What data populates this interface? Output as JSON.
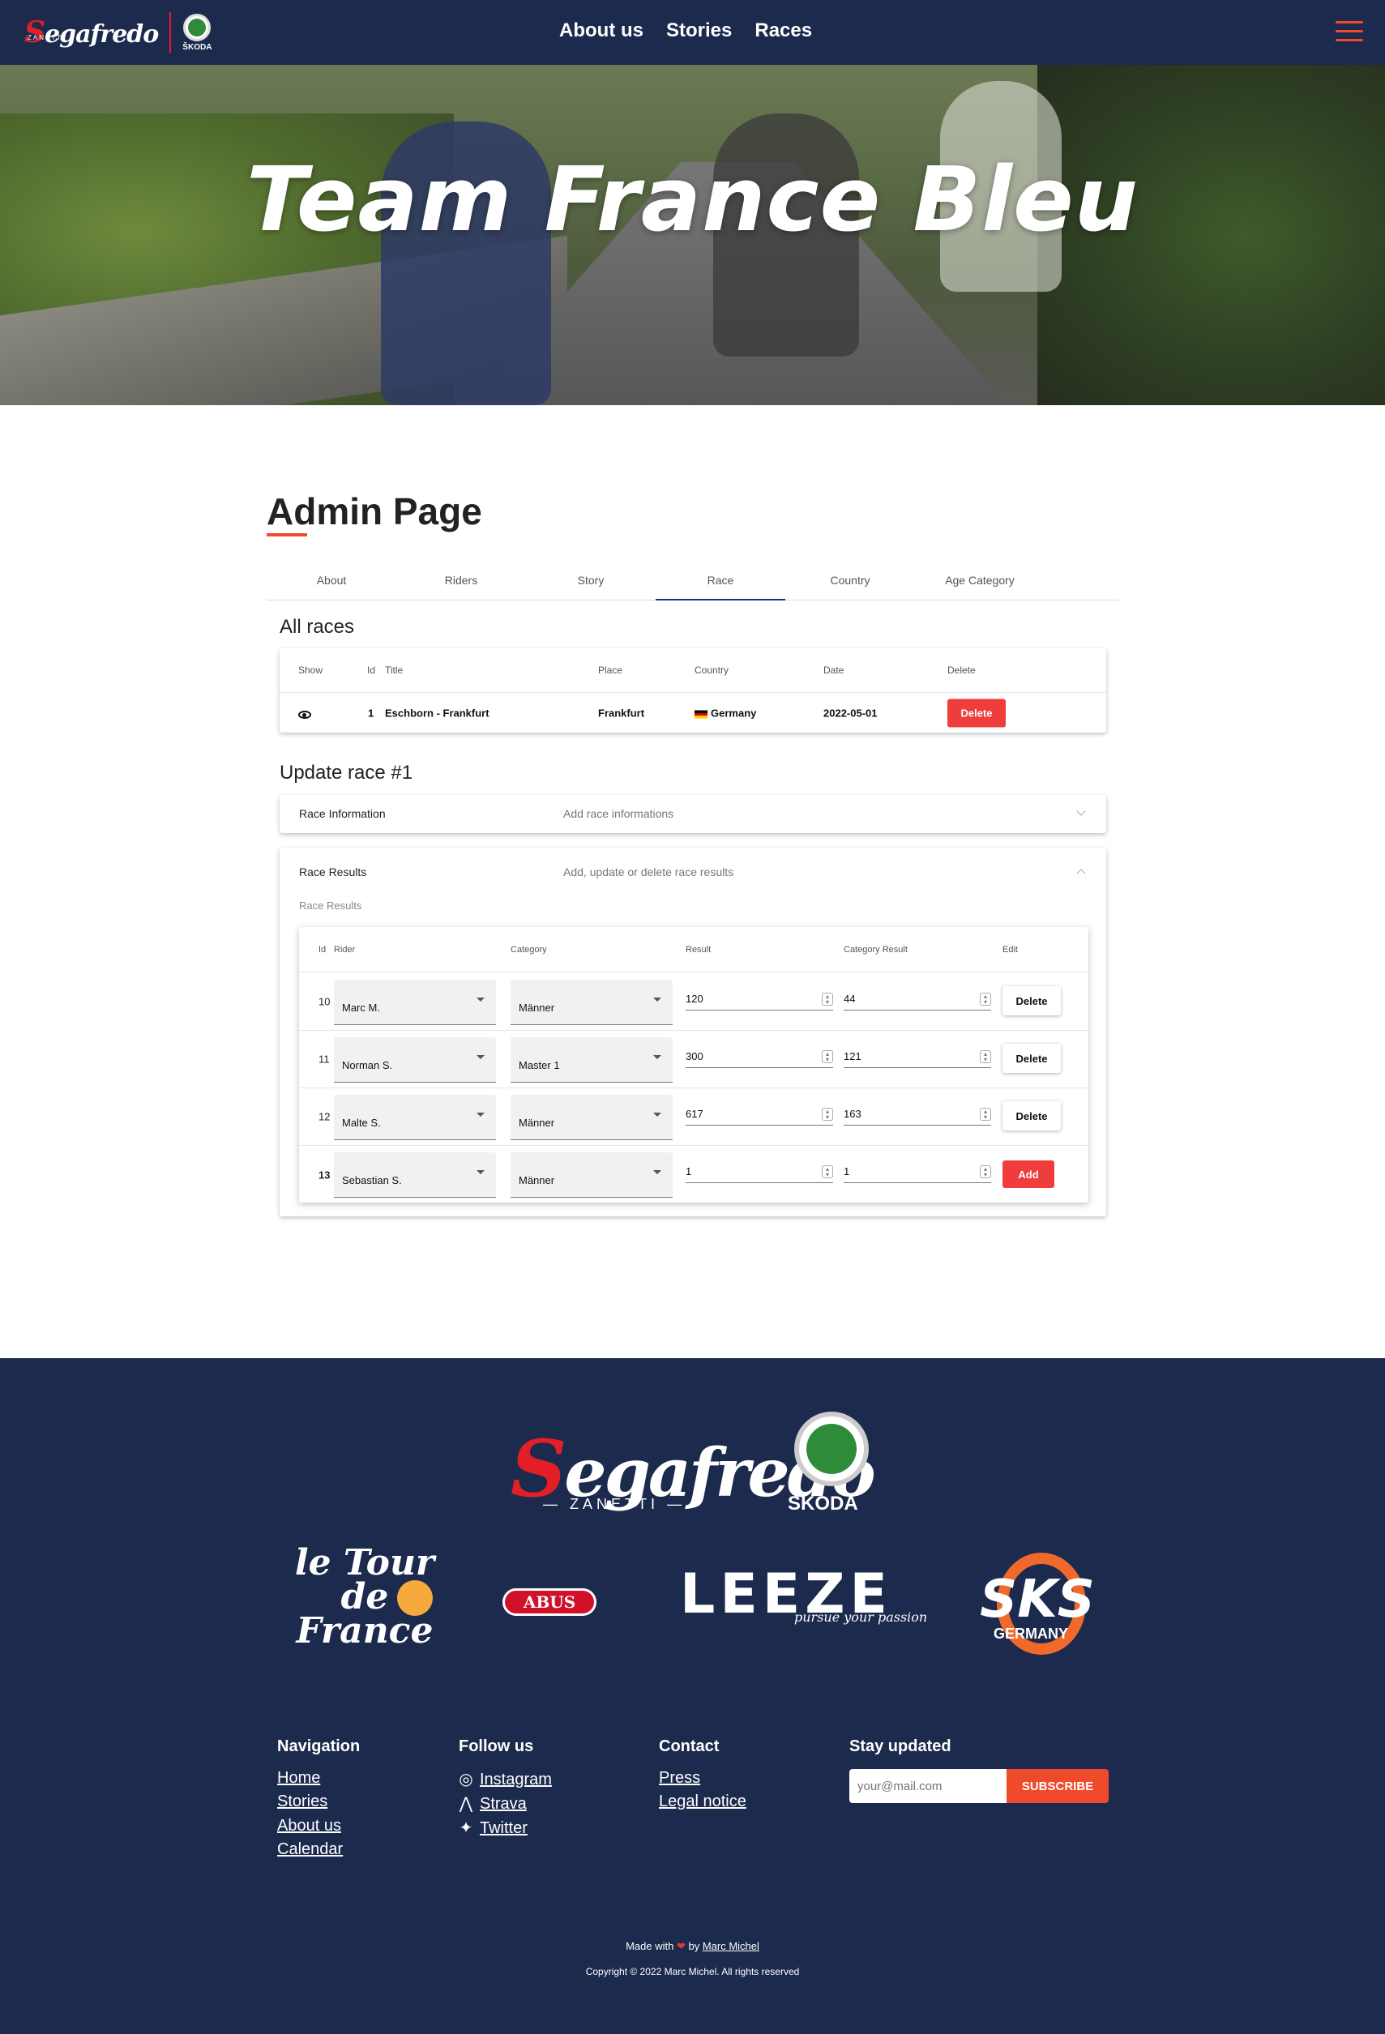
{
  "nav": {
    "brand_segafredo": "egafredo",
    "brand_s": "S",
    "brand_zanetti": "ZANETTI",
    "brand_skoda": "ŠKODA",
    "links": [
      "About us",
      "Stories",
      "Races"
    ]
  },
  "hero": {
    "title": "Team France Bleu"
  },
  "admin": {
    "title": "Admin Page",
    "tabs": [
      "About",
      "Riders",
      "Story",
      "Race",
      "Country",
      "Age Category"
    ],
    "active_tab": "Race"
  },
  "races": {
    "heading": "All races",
    "columns": [
      "Show",
      "Id",
      "Title",
      "Place",
      "Country",
      "Date",
      "Delete"
    ],
    "rows": [
      {
        "id": "1",
        "title": "Eschborn - Frankfurt",
        "place": "Frankfurt",
        "country": "Germany",
        "date": "2022-05-01",
        "delete": "Delete"
      }
    ]
  },
  "update": {
    "heading": "Update race #1",
    "info_title": "Race Information",
    "info_sub": "Add race informations",
    "results_title": "Race Results",
    "results_sub": "Add, update or delete race results",
    "results_label": "Race Results",
    "columns": [
      "Id",
      "Rider",
      "Category",
      "Result",
      "Category Result",
      "Edit"
    ],
    "rows": [
      {
        "id": "10",
        "rider": "Marc M.",
        "category": "Männer",
        "result": "120",
        "category_result": "44",
        "action": "Delete"
      },
      {
        "id": "11",
        "rider": "Norman S.",
        "category": "Master 1",
        "result": "300",
        "category_result": "121",
        "action": "Delete"
      },
      {
        "id": "12",
        "rider": "Malte S.",
        "category": "Männer",
        "result": "617",
        "category_result": "163",
        "action": "Delete"
      },
      {
        "id": "13",
        "rider": "Sebastian S.",
        "category": "Männer",
        "result": "1",
        "category_result": "1",
        "action": "Add"
      }
    ]
  },
  "footer": {
    "segafredo": "egafredo",
    "segafredo_s": "S",
    "zanetti": "— ZANETTI —",
    "skoda": "ŠKODA",
    "tour": "le Tour de France",
    "abus": "ABUS",
    "leeze": "LEEZE",
    "leeze_sub": "pursue your passion",
    "sks": "SKS",
    "sks_sub": "GERMANY",
    "navigation": {
      "heading": "Navigation",
      "links": [
        "Home",
        "Stories",
        "About us",
        "Calendar"
      ]
    },
    "follow": {
      "heading": "Follow us",
      "links": [
        "Instagram",
        "Strava",
        "Twitter"
      ]
    },
    "contact": {
      "heading": "Contact",
      "links": [
        "Press",
        "Legal notice"
      ]
    },
    "stay": {
      "heading": "Stay updated",
      "placeholder": "your@mail.com",
      "button": "SUBSCRIBE"
    },
    "made_prefix": "Made with",
    "made_by": "by",
    "author": "Marc Michel",
    "copyright": "Copyright © 2022 Marc Michel. All rights reserved"
  },
  "colors": {
    "navy": "#1c2a4d",
    "accent": "#ef4a2b",
    "danger": "#ef3d3d"
  }
}
